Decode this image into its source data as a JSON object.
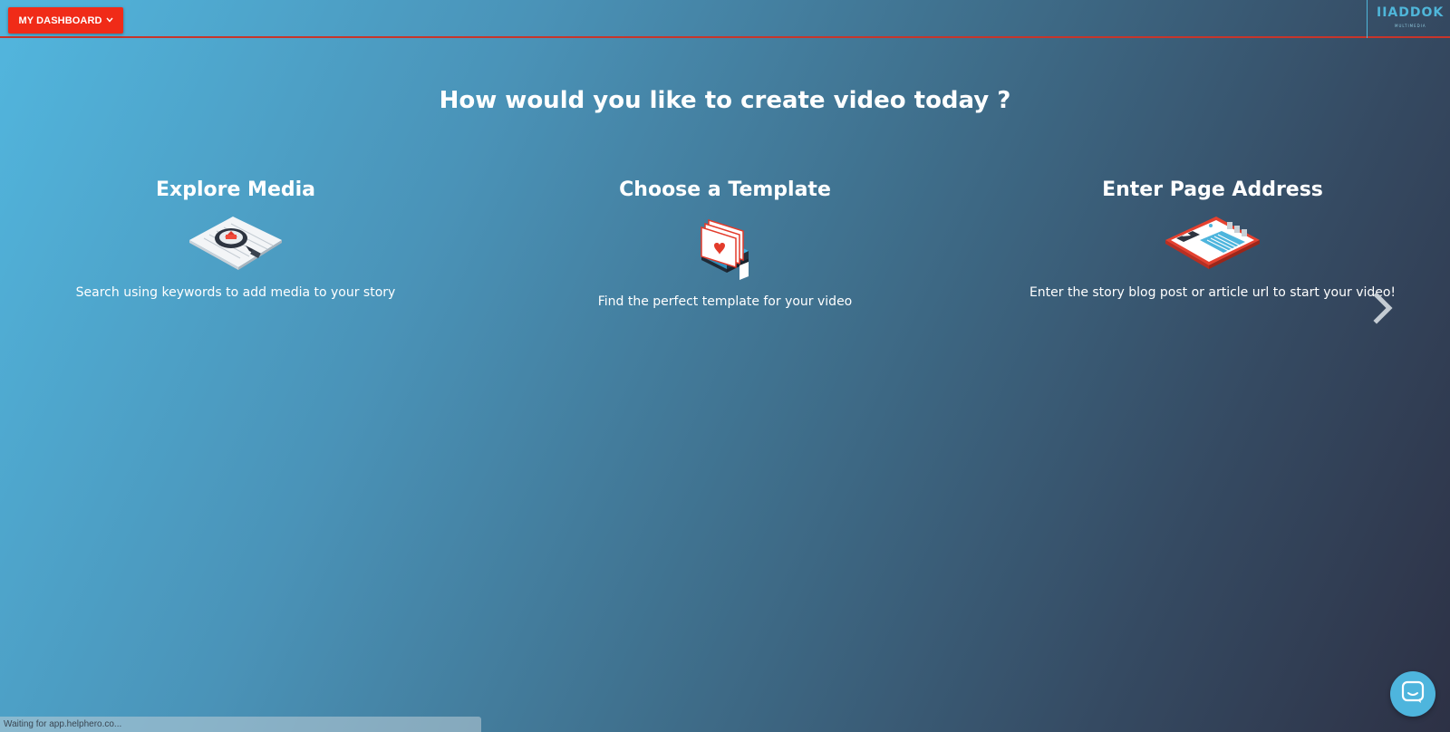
{
  "header": {
    "dashboard_button_label": "MY DASHBOARD",
    "logo_text": "IIADDOK",
    "logo_subtext": "MULTIMEDIA"
  },
  "main": {
    "headline": "How would you like to create video today ?",
    "options": [
      {
        "title": "Explore Media",
        "description": "Search using keywords to add media to your story",
        "icon": "magnifier-on-document-icon"
      },
      {
        "title": "Choose a Template",
        "description": "Find the perfect template for your video",
        "icon": "template-cards-icon"
      },
      {
        "title": "Enter Page Address",
        "description": "Enter the story blog post or article url to start your video!",
        "icon": "web-page-icon"
      }
    ],
    "next_icon": "chevron-right-icon"
  },
  "chat": {
    "icon": "chat-bubble-icon"
  },
  "status_bar": {
    "text": "Waiting for app.helphero.co..."
  },
  "colors": {
    "accent_red": "#f02b18",
    "accent_blue": "#4eb5dd",
    "gradient_start": "#52b6de",
    "gradient_end": "#2d3145"
  }
}
